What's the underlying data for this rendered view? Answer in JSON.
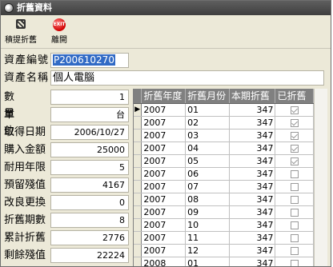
{
  "window": {
    "title": "折舊資料"
  },
  "toolbar": {
    "provision_label": "積提折舊",
    "exit_label": "離開",
    "exit_icon_text": "EXIT"
  },
  "asset": {
    "no_label": "資產編號",
    "no_value": "P200610270",
    "name_label": "資產名稱",
    "name_value": "個人電腦"
  },
  "props": [
    {
      "label": "數量",
      "value": "1"
    },
    {
      "label": "單位",
      "value": "台"
    },
    {
      "label": "取得日期",
      "value": "2006/10/27"
    },
    {
      "label": "購入金額",
      "value": "25000"
    },
    {
      "label": "耐用年限",
      "value": "5"
    },
    {
      "label": "預留殘值",
      "value": "4167"
    },
    {
      "label": "改良更換",
      "value": "0"
    },
    {
      "label": "折舊期數",
      "value": "8"
    },
    {
      "label": "累計折舊",
      "value": "2776"
    },
    {
      "label": "剩餘殘值",
      "value": "22224"
    }
  ],
  "grid": {
    "columns": [
      "折舊年度",
      "折舊月份",
      "本期折舊",
      "已折舊"
    ],
    "rows": [
      {
        "year": "2007",
        "month": "01",
        "amount": "347",
        "done": true
      },
      {
        "year": "2007",
        "month": "02",
        "amount": "347",
        "done": true
      },
      {
        "year": "2007",
        "month": "03",
        "amount": "347",
        "done": true
      },
      {
        "year": "2007",
        "month": "04",
        "amount": "347",
        "done": true
      },
      {
        "year": "2007",
        "month": "05",
        "amount": "347",
        "done": true
      },
      {
        "year": "2007",
        "month": "06",
        "amount": "347",
        "done": false
      },
      {
        "year": "2007",
        "month": "07",
        "amount": "347",
        "done": false
      },
      {
        "year": "2007",
        "month": "08",
        "amount": "347",
        "done": false
      },
      {
        "year": "2007",
        "month": "09",
        "amount": "347",
        "done": false
      },
      {
        "year": "2007",
        "month": "10",
        "amount": "347",
        "done": false
      },
      {
        "year": "2007",
        "month": "11",
        "amount": "347",
        "done": false
      },
      {
        "year": "2007",
        "month": "12",
        "amount": "347",
        "done": false
      },
      {
        "year": "2008",
        "month": "01",
        "amount": "347",
        "done": false
      }
    ],
    "current_row_marker": "▶"
  }
}
